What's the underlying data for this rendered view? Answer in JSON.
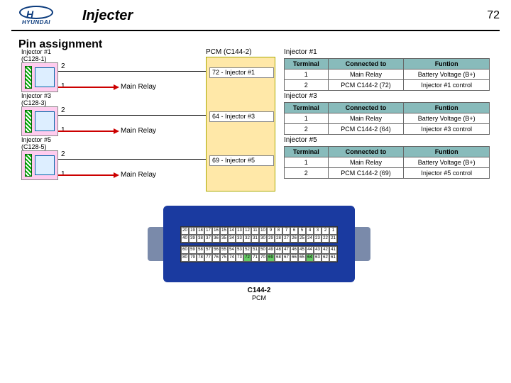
{
  "header": {
    "brand": "HYUNDAI",
    "title": "Injecter",
    "page": "72"
  },
  "subtitle": "Pin assignment",
  "injectors": [
    {
      "name": "Injector #1",
      "conn": "(C128-1)",
      "pin1": "1",
      "pin2": "2",
      "relay": "Main Relay"
    },
    {
      "name": "Injector #3",
      "conn": "(C128-3)",
      "pin1": "1",
      "pin2": "2",
      "relay": "Main Relay"
    },
    {
      "name": "Injector #5",
      "conn": "(C128-5)",
      "pin1": "1",
      "pin2": "2",
      "relay": "Main Relay"
    }
  ],
  "pcm": {
    "label": "PCM (C144-2)",
    "pins": [
      {
        "text": "72 - Injector #1"
      },
      {
        "text": "64 - Injector #3"
      },
      {
        "text": "69 - Injector #5"
      }
    ]
  },
  "tables": {
    "headers": [
      "Terminal",
      "Connected to",
      "Funtion"
    ],
    "groups": [
      {
        "title": "Injector #1",
        "rows": [
          [
            "1",
            "Main Relay",
            "Battery Voltage (B+)"
          ],
          [
            "2",
            "PCM C144-2 (72)",
            "Injector #1 control"
          ]
        ]
      },
      {
        "title": "Injector #3",
        "rows": [
          [
            "1",
            "Main Relay",
            "Battery Voltage (B+)"
          ],
          [
            "2",
            "PCM C144-2 (64)",
            "Injector #3 control"
          ]
        ]
      },
      {
        "title": "Injector #5",
        "rows": [
          [
            "1",
            "Main Relay",
            "Battery Voltage (B+)"
          ],
          [
            "2",
            "PCM C144-2 (69)",
            "Injector #5 control"
          ]
        ]
      }
    ]
  },
  "connector": {
    "label": "C144-2",
    "sub": "PCM",
    "highlight": [
      64,
      69,
      72
    ],
    "rows": [
      [
        20,
        19,
        18,
        17,
        16,
        15,
        14,
        13,
        12,
        11,
        10,
        9,
        8,
        7,
        6,
        5,
        4,
        3,
        2,
        1
      ],
      [
        40,
        39,
        38,
        37,
        36,
        35,
        34,
        33,
        32,
        31,
        30,
        29,
        28,
        27,
        26,
        25,
        24,
        23,
        22,
        21
      ],
      [
        60,
        59,
        58,
        57,
        56,
        55,
        54,
        53,
        52,
        51,
        50,
        49,
        48,
        47,
        46,
        45,
        44,
        43,
        42,
        41
      ],
      [
        80,
        79,
        78,
        77,
        76,
        75,
        74,
        73,
        72,
        71,
        70,
        69,
        68,
        67,
        66,
        65,
        64,
        63,
        62,
        61
      ]
    ]
  }
}
